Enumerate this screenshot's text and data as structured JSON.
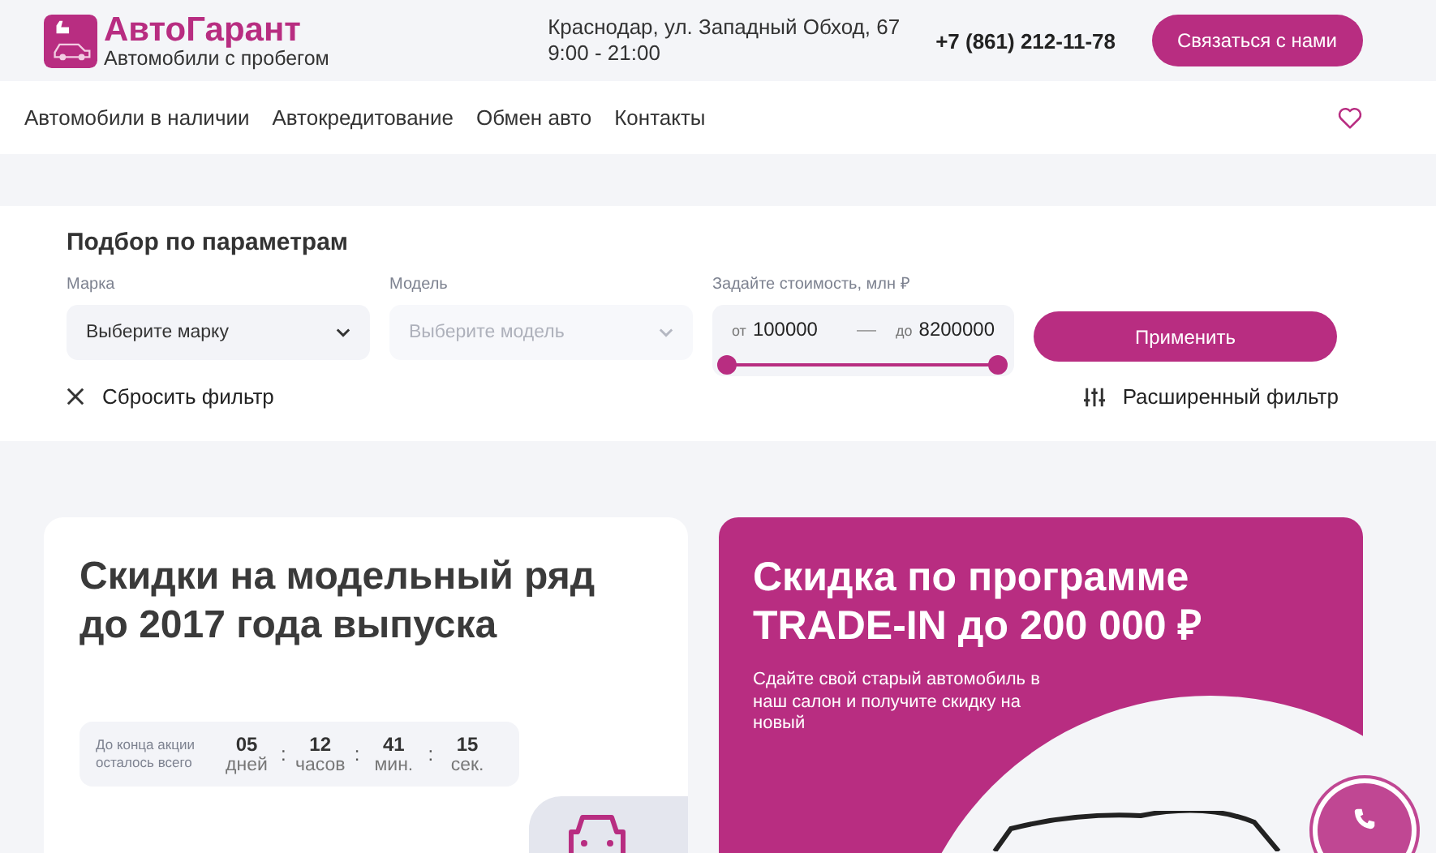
{
  "header": {
    "brand": "АвтоГарант",
    "tagline": "Автомобили с пробегом",
    "address": "Краснодар, ул. Западный Обход, 67",
    "hours": "9:00 - 21:00",
    "phone": "+7 (861) 212-11-78",
    "contact_button": "Связаться с нами"
  },
  "nav": {
    "items": [
      {
        "label": "Автомобили в наличии"
      },
      {
        "label": "Автокредитование"
      },
      {
        "label": "Обмен авто"
      },
      {
        "label": "Контакты"
      }
    ]
  },
  "filter": {
    "title": "Подбор по параметрам",
    "selects": [
      {
        "label": "Марка",
        "placeholder": "Выберите марку",
        "disabled": false
      },
      {
        "label": "Модель",
        "placeholder": "Выберите модель",
        "disabled": true
      }
    ],
    "price": {
      "label": "Задайте стоимость, млн ₽",
      "from_prefix": "от",
      "from": "100000",
      "separator": "—",
      "to_prefix": "до",
      "to": "8200000",
      "thumbs": [
        {
          "level": 0
        },
        {
          "level": 1
        }
      ]
    },
    "apply_button": "Применить",
    "reset": "Сбросить фильтр",
    "advanced": "Расширенный фильтр"
  },
  "promos": [
    {
      "kind": "countdown",
      "title": "Скидки на модельный ряд до 2017 года выпуска",
      "countdown_label": "До конца акции осталось всего",
      "units": [
        {
          "value": "05",
          "unit": "дней"
        },
        {
          "value": "12",
          "unit": "часов"
        },
        {
          "value": "41",
          "unit": "мин."
        },
        {
          "value": "15",
          "unit": "сек."
        }
      ],
      "separator": ":"
    },
    {
      "kind": "tradein",
      "title": "Скидка по программе TRADE-IN до 200 000 ₽",
      "text": "Сдайте свой старый автомобиль в наш салон и получите скидку на новый"
    }
  ]
}
